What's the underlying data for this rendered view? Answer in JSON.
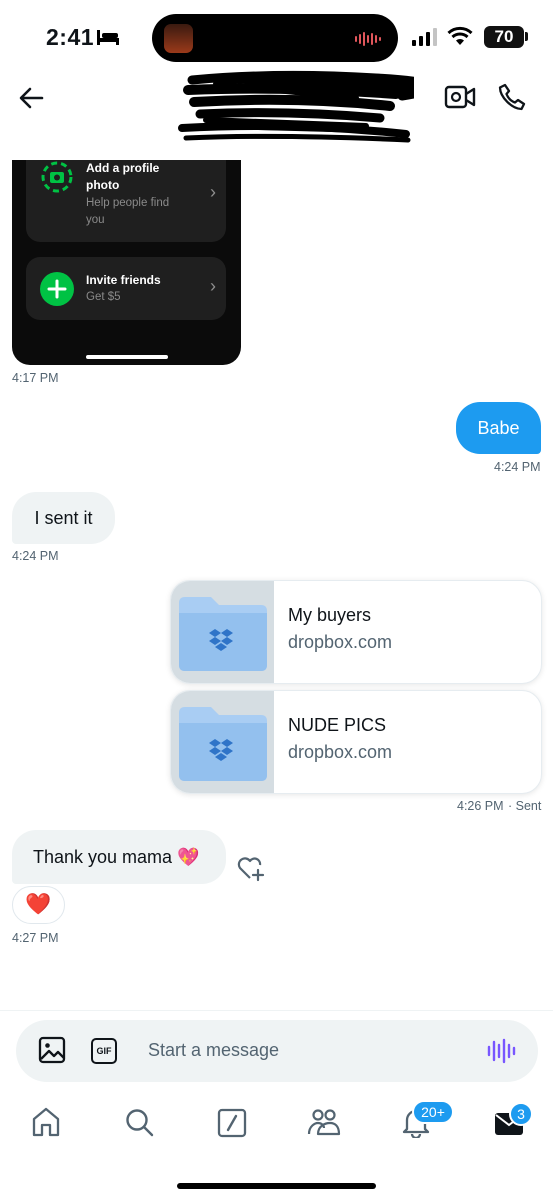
{
  "status_bar": {
    "time": "2:41",
    "battery": "70"
  },
  "embedded_screenshot": {
    "profile_card": {
      "title_1": "Add a profile",
      "title_2": "photo",
      "sub_1": "Help people find",
      "sub_2": "you"
    },
    "invite_card": {
      "title": "Invite friends",
      "sub": "Get $5"
    }
  },
  "messages": {
    "screenshot_time": "4:17 PM",
    "babe_text": "Babe",
    "babe_time": "4:24 PM",
    "sent_it_text": "I sent it",
    "sent_it_time": "4:24 PM",
    "links": [
      {
        "title": "My buyers",
        "domain": "dropbox.com"
      },
      {
        "title": "NUDE PICS",
        "domain": "dropbox.com"
      }
    ],
    "links_time": "4:26 PM",
    "links_status": "· Sent",
    "thanks_text": "Thank you mama 💖",
    "reaction": "❤️",
    "thanks_time": "4:27 PM"
  },
  "composer": {
    "placeholder": "Start a message",
    "gif_label": "GIF"
  },
  "tab_bar": {
    "notifications_badge": "20+",
    "messages_badge": "3"
  },
  "icons": {
    "back": "back-arrow-icon",
    "video": "video-camera-icon",
    "phone": "phone-icon",
    "media": "image-icon",
    "voice": "voice-wave-icon",
    "home": "home-icon",
    "search": "search-icon",
    "grok": "slash-box-icon",
    "communities": "people-icon",
    "notifications": "bell-icon",
    "messages": "envelope-icon"
  },
  "colors": {
    "accent": "#1d9bf0",
    "voice": "#7856ff",
    "invite_green": "#00c244"
  }
}
